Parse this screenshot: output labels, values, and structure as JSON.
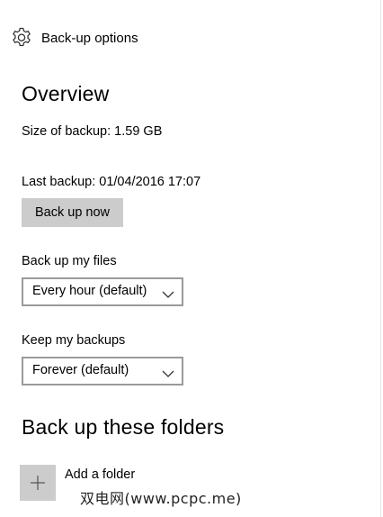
{
  "header": {
    "icon": "gear-icon",
    "title": "Back-up options"
  },
  "overview": {
    "title": "Overview",
    "size_label": "Size of backup: 1.59 GB",
    "last_backup_label": "Last backup: 01/04/2016 17:07",
    "backup_now_button": "Back up now"
  },
  "backup_files": {
    "label": "Back up my files",
    "selected": "Every hour (default)"
  },
  "keep_backups": {
    "label": "Keep my backups",
    "selected": "Forever (default)"
  },
  "folders": {
    "title": "Back up these folders",
    "add_label": "Add a folder",
    "add_icon": "plus-icon"
  },
  "watermark": "双电网(www.pcpc.me)"
}
